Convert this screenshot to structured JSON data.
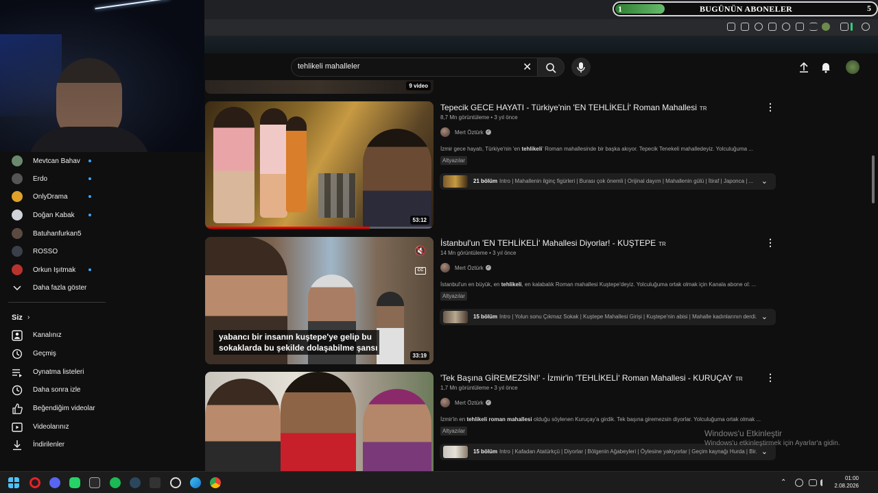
{
  "overlay": {
    "banner_count": "1",
    "banner_title": "BUGÜNÜN ABONELER",
    "banner_right": "5"
  },
  "subscriptions": [
    {
      "name": "Mevtcan Bahav",
      "color": "#6a8a6e",
      "live_dot": true
    },
    {
      "name": "Erdo",
      "color": "#555555",
      "live_dot": true
    },
    {
      "name": "OnlyDrama",
      "color": "#e0a12a",
      "live_dot": true
    },
    {
      "name": "Doğan Kabak",
      "color": "#cfd3d9",
      "live_dot": true
    },
    {
      "name": "Batuhanfurkan5",
      "color": "#5b4a40",
      "live_dot": false
    },
    {
      "name": "ROSSO",
      "color": "#3b3f4a",
      "live_dot": false
    },
    {
      "name": "Orkun Işıtmak",
      "color": "#b8332e",
      "live_dot": true
    }
  ],
  "sidebar": {
    "show_more": "Daha fazla göster",
    "you_header": "Siz",
    "you_items": [
      {
        "label": "Kanalınız",
        "icon": "account-box-icon"
      },
      {
        "label": "Geçmiş",
        "icon": "history-icon"
      },
      {
        "label": "Oynatma listeleri",
        "icon": "playlist-icon"
      },
      {
        "label": "Daha sonra izle",
        "icon": "clock-icon"
      },
      {
        "label": "Beğendiğim videolar",
        "icon": "thumbs-up-icon"
      },
      {
        "label": "Videolarınız",
        "icon": "video-icon"
      },
      {
        "label": "İndirilenler",
        "icon": "download-icon"
      }
    ]
  },
  "search": {
    "query": "tehlikeli mahalleler"
  },
  "prev_result": {
    "badge": "9 video"
  },
  "results": [
    {
      "title": "Tepecik GECE HAYATI - Türkiye'nin 'EN TEHLİKELİ' Roman Mahallesi",
      "lang": "TR",
      "meta": "8,7 Mn görüntüleme • 3 yıl önce",
      "channel": "Mert Öztürk",
      "desc_pre": "İzmir gece hayatı, Türkiye'nin 'en ",
      "desc_bold": "tehlikeli",
      "desc_post": "' Roman mahallesinde bir başka akıyor. Tepecik Tenekeli mahalledeyiz. Yolculuğuma ...",
      "tag": "Altyazılar",
      "chapter_count": "21 bölüm",
      "chapters": "Intro | Mahallenin ilginç figürleri | Burası çok önemli | Orijinal dayım | Mahallenin gülü | İtiraf | Japonca | ...",
      "duration": "53:12",
      "progress": 0.72
    },
    {
      "title": "İstanbul'un 'EN TEHLİKELİ' Mahallesi Diyorlar! - KUŞTEPE",
      "lang": "TR",
      "meta": "14 Mn görüntüleme • 3 yıl önce",
      "channel": "Mert Öztürk",
      "desc_pre": "İstanbul'un en büyük, en ",
      "desc_bold": "tehlikeli",
      "desc_post": ", en kalabalık Roman mahallesi Kuştepe'deyiz. Yolculuğuma ortak olmak için Kanala abone ol: ...",
      "tag": "Altyazılar",
      "chapter_count": "15 bölüm",
      "chapters": "Intro | Yolun sonu Çıkmaz Sokak | Kuştepe Mahallesi Girişi | Kuştepe'nin abisi | Mahalle kadınlarının derdi...",
      "duration": "33:19",
      "subtitle_1": "yabancı bir insanın kuştepe'ye gelip bu",
      "subtitle_2": "sokaklarda bu şekilde dolaşabilme şansı",
      "cc": "CC"
    },
    {
      "title": "'Tek Başına GİREMEZSİN!' - İzmir'in 'TEHLİKELİ' Roman Mahallesi - KURUÇAY",
      "lang": "TR",
      "meta": "1,7 Mn görüntüleme • 3 yıl önce",
      "channel": "Mert Öztürk",
      "desc_pre": "İzmir'in en ",
      "desc_bold": "tehlikeli roman mahallesi",
      "desc_post": " olduğu söylenen Kuruçay'a girdik. Tek başına giremezsin diyorlar. Yolculuğuma ortak olmak ...",
      "tag": "Altyazılar",
      "chapter_count": "15 bölüm",
      "chapters": "Intro | Kafadan Atatürkçü | Diyorlar | Bölgenin Ağabeyleri | Öylesine yakıyorlar | Geçim kaynağı Hurda | Bir...",
      "duration": ""
    }
  ],
  "watermark": {
    "line1": "Windows'u Etkinleştir",
    "line2": "Windows'u etkinleştirmek için Ayarlar'a gidin."
  },
  "taskbar": {
    "time": "01:00",
    "date": "2.08.2026"
  },
  "colors": {
    "accent_red": "#ff0000",
    "link_blue": "#3ea6ff"
  }
}
